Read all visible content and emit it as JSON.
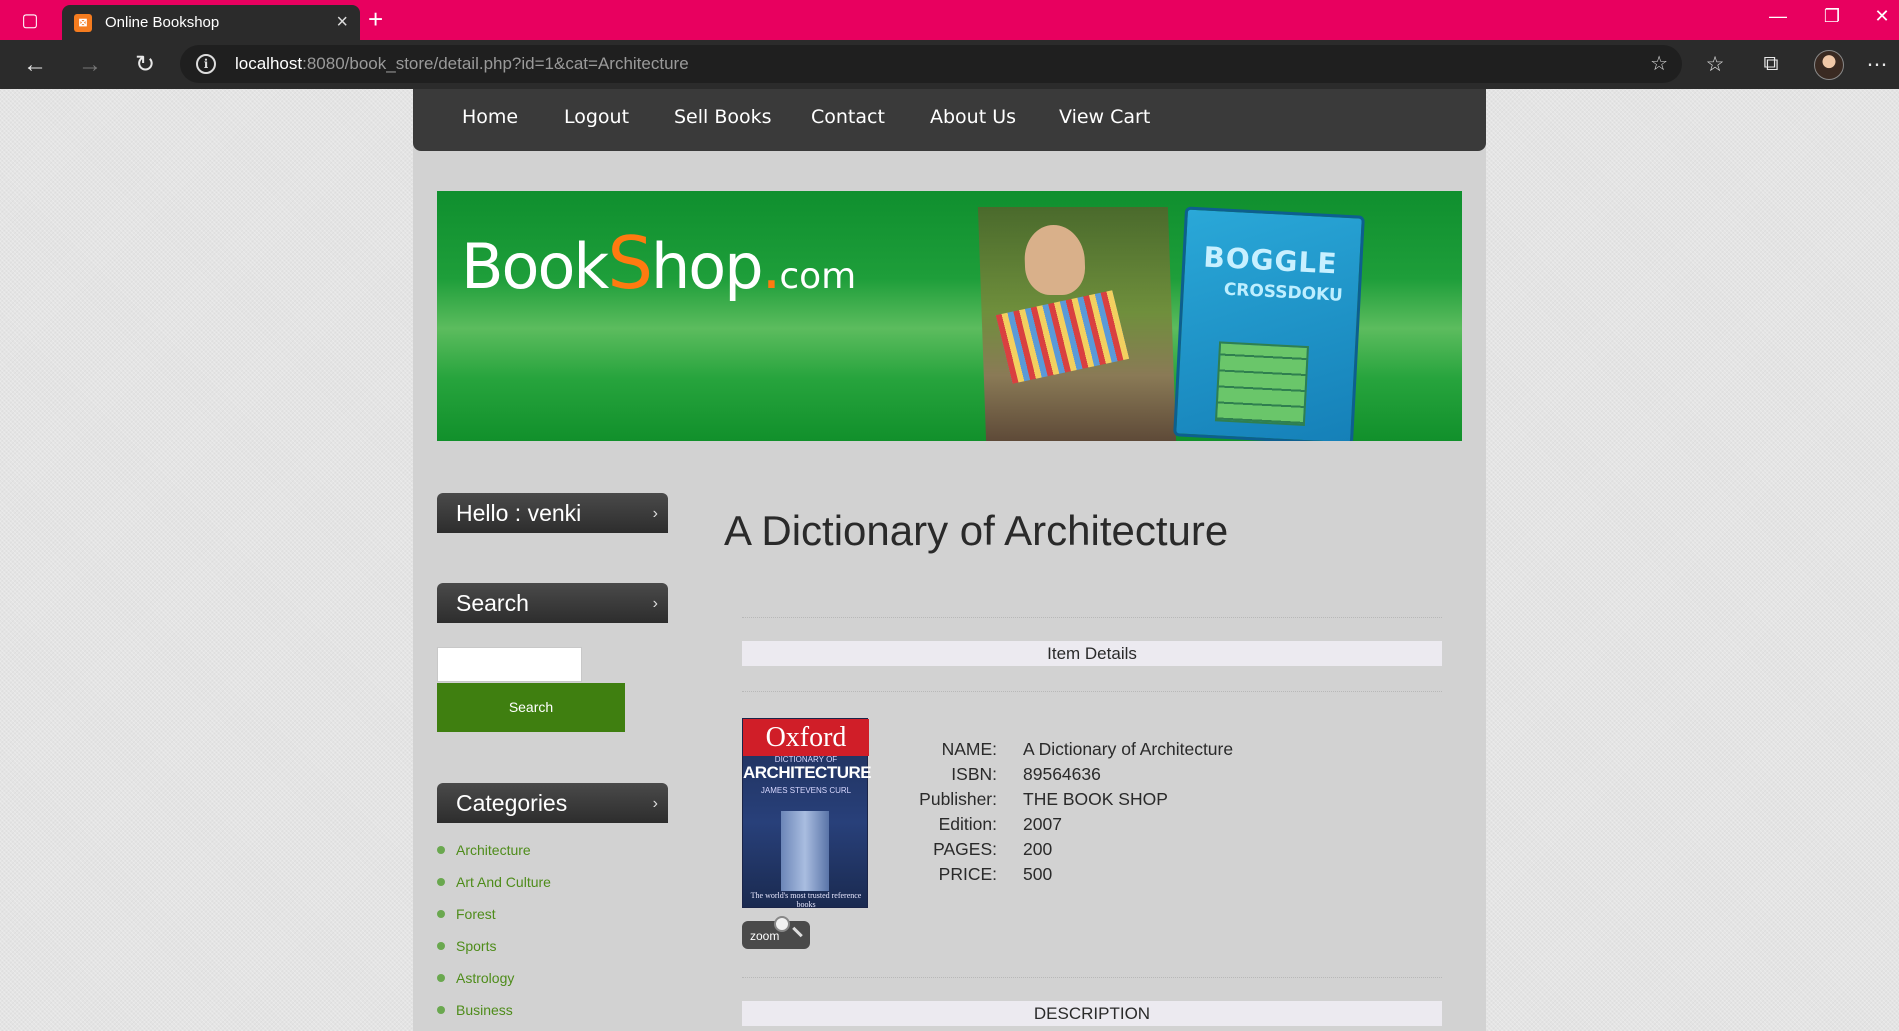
{
  "browser": {
    "tab_title": "Online Bookshop",
    "url_host": "localhost",
    "url_rest": ":8080/book_store/detail.php?id=1&cat=Architecture"
  },
  "nav": {
    "items": [
      "Home",
      "Logout",
      "Sell Books",
      "Contact",
      "About Us",
      "View Cart"
    ]
  },
  "banner": {
    "logo_book": "Book",
    "logo_s": "S",
    "logo_hop": "hop",
    "logo_dot": ".",
    "logo_com": "com",
    "game_title": "BOGGLE",
    "game_subtitle": "CROSSDOKU"
  },
  "sidebar": {
    "greeting": "Hello : venki",
    "search_heading": "Search",
    "search_value": "",
    "search_button": "Search",
    "categories_heading": "Categories",
    "categories": [
      "Architecture",
      "Art And Culture",
      "Forest",
      "Sports",
      "Astrology",
      "Business"
    ]
  },
  "book": {
    "title": "A Dictionary of Architecture",
    "item_details_heading": "Item Details",
    "description_heading": "DESCRIPTION",
    "cover": {
      "brand": "Oxford",
      "dictionary_of": "DICTIONARY OF",
      "subject": "ARCHITECTURE",
      "author": "JAMES STEVENS CURL",
      "tagline": "The world's most trusted reference books"
    },
    "zoom_label": "zoom",
    "details": [
      {
        "label": "NAME:",
        "value": "A Dictionary of Architecture"
      },
      {
        "label": "ISBN:",
        "value": "89564636"
      },
      {
        "label": "Publisher:",
        "value": "THE BOOK SHOP"
      },
      {
        "label": "Edition:",
        "value": "2007"
      },
      {
        "label": "PAGES:",
        "value": "200"
      },
      {
        "label": "PRICE:",
        "value": "500"
      }
    ]
  }
}
